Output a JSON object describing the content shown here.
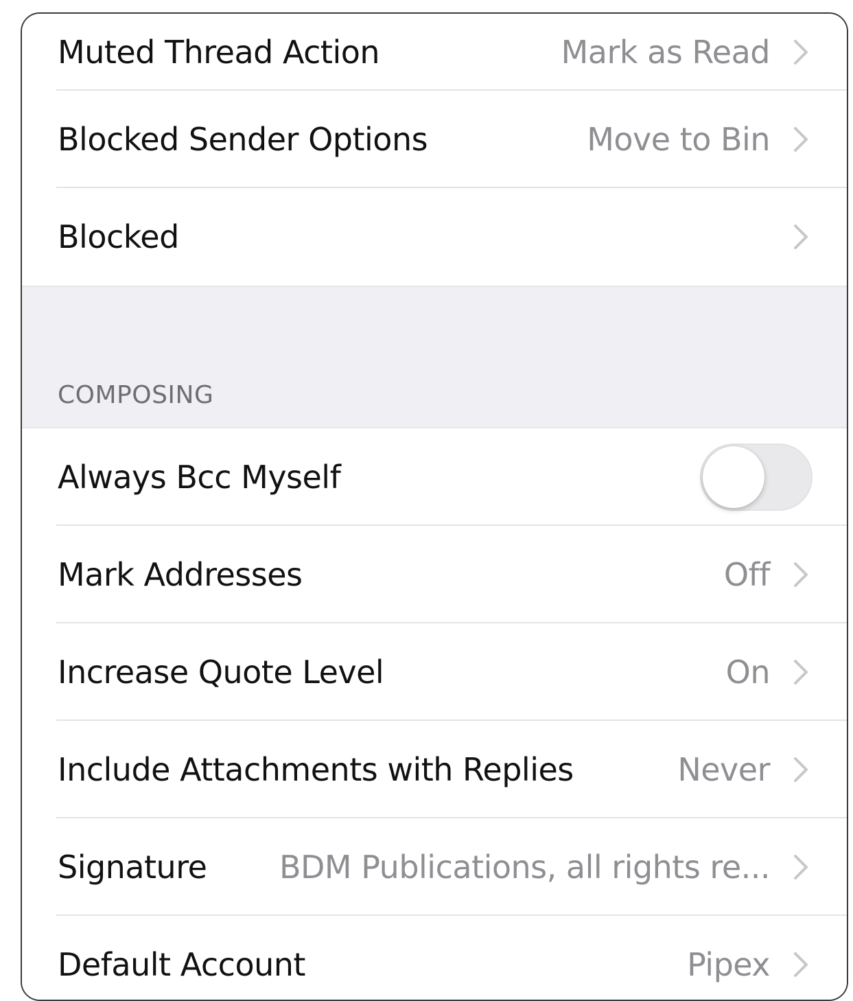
{
  "mail_settings": {
    "rows_top": [
      {
        "label": "Muted Thread Action",
        "value": "Mark as Read"
      },
      {
        "label": "Blocked Sender Options",
        "value": "Move to Bin"
      },
      {
        "label": "Blocked",
        "value": ""
      }
    ],
    "composing": {
      "header": "COMPOSING",
      "always_bcc": {
        "label": "Always Bcc Myself",
        "toggle_on": false
      },
      "rows": [
        {
          "label": "Mark Addresses",
          "value": "Off"
        },
        {
          "label": "Increase Quote Level",
          "value": "On"
        },
        {
          "label": "Include Attachments with Replies",
          "value": "Never"
        },
        {
          "label": "Signature",
          "value": "BDM Publications, all rights re..."
        },
        {
          "label": "Default Account",
          "value": "Pipex"
        }
      ]
    },
    "icons": {
      "disclosure": "chevron-right-icon"
    },
    "colors": {
      "label": "#111111",
      "value": "#8e8e93",
      "section_bg": "#efeff4",
      "toggle_off": "#e9e9eb"
    }
  }
}
